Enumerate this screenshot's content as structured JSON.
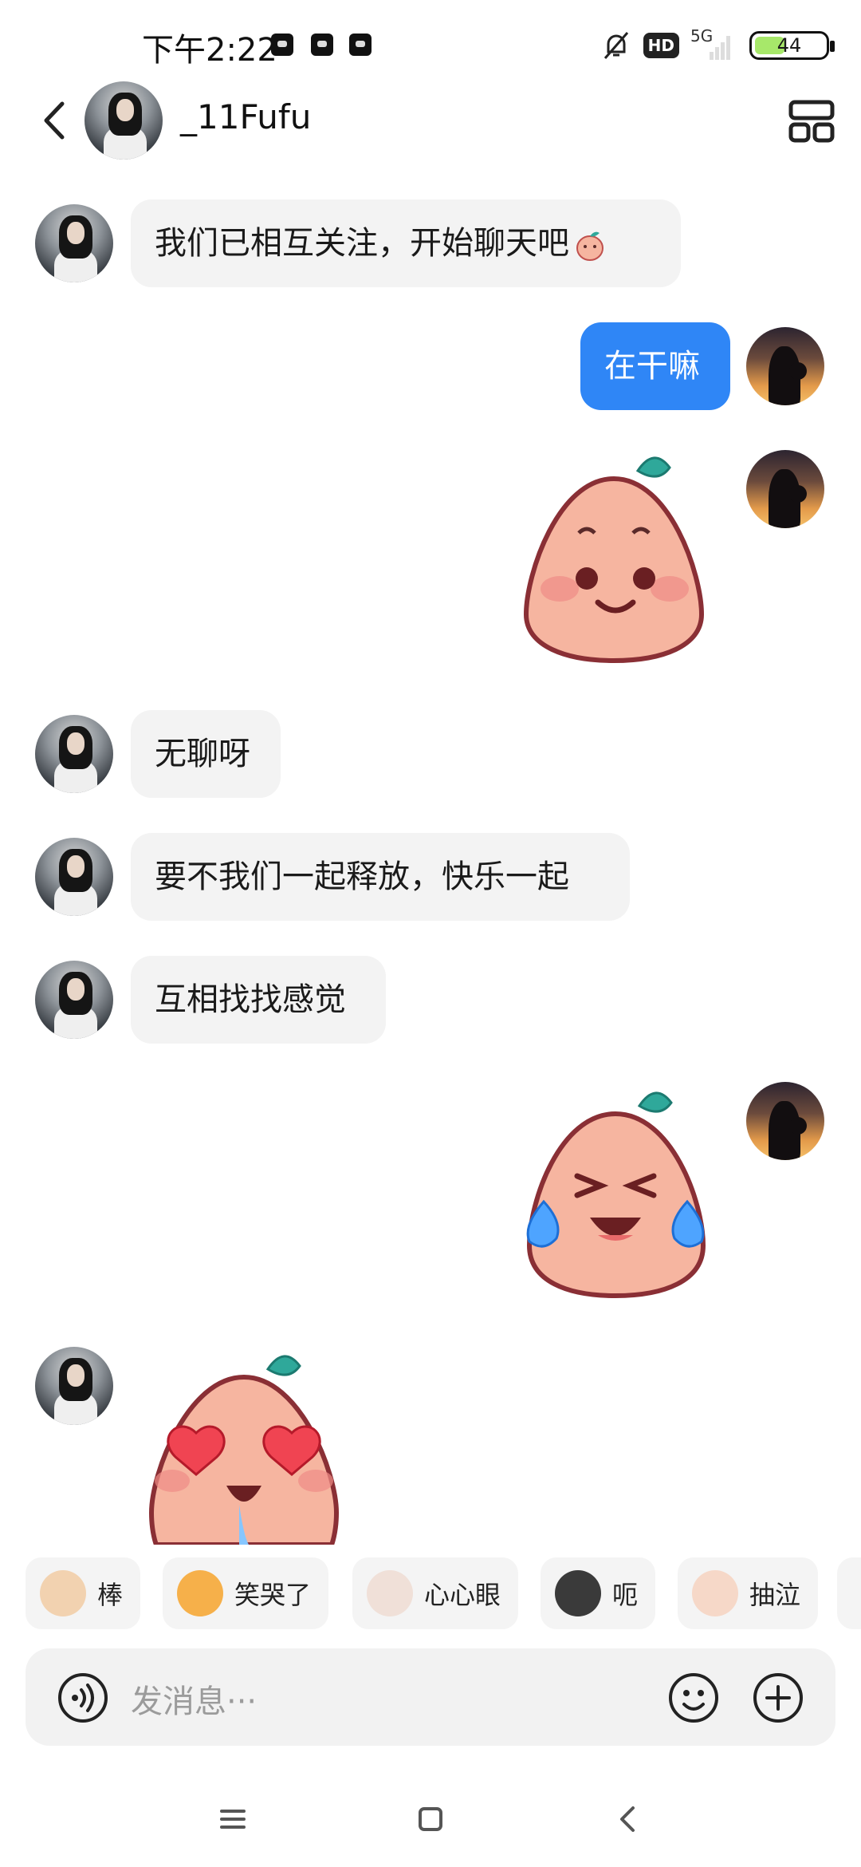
{
  "status_bar": {
    "time": "下午2:22",
    "network": "5G",
    "hd_label": "HD",
    "battery": "44",
    "battery_level": 0.44
  },
  "header": {
    "title": "_11Fufu"
  },
  "messages": [
    {
      "side": "in",
      "type": "text",
      "text": "我们已相互关注，开始聊天吧"
    },
    {
      "side": "out",
      "type": "text",
      "text": "在干嘛"
    },
    {
      "side": "out",
      "type": "sticker",
      "sticker": "peach-smile"
    },
    {
      "side": "in",
      "type": "text",
      "text": "无聊呀"
    },
    {
      "side": "in",
      "type": "text",
      "text": "要不我们一起释放，快乐一起"
    },
    {
      "side": "in",
      "type": "text",
      "text": "互相找找感觉"
    },
    {
      "side": "out",
      "type": "sticker",
      "sticker": "peach-laugh-cry"
    },
    {
      "side": "in",
      "type": "sticker",
      "sticker": "peach-heart-eyes"
    }
  ],
  "quick_stickers": [
    {
      "label": "棒",
      "icon": "cat-thumbs-up-icon"
    },
    {
      "label": "笑哭了",
      "icon": "cat-laugh-cry-icon"
    },
    {
      "label": "心心眼",
      "icon": "cat-heart-eyes-icon"
    },
    {
      "label": "呃",
      "icon": "cat-awkward-icon"
    },
    {
      "label": "抽泣",
      "icon": "cat-sob-icon"
    }
  ],
  "input": {
    "placeholder": "发消息···"
  },
  "colors": {
    "outgoing_bubble": "#2f86f6",
    "incoming_bubble": "#f3f3f3",
    "peach_body": "#f6b5a0",
    "peach_leaf": "#2fa89a"
  }
}
